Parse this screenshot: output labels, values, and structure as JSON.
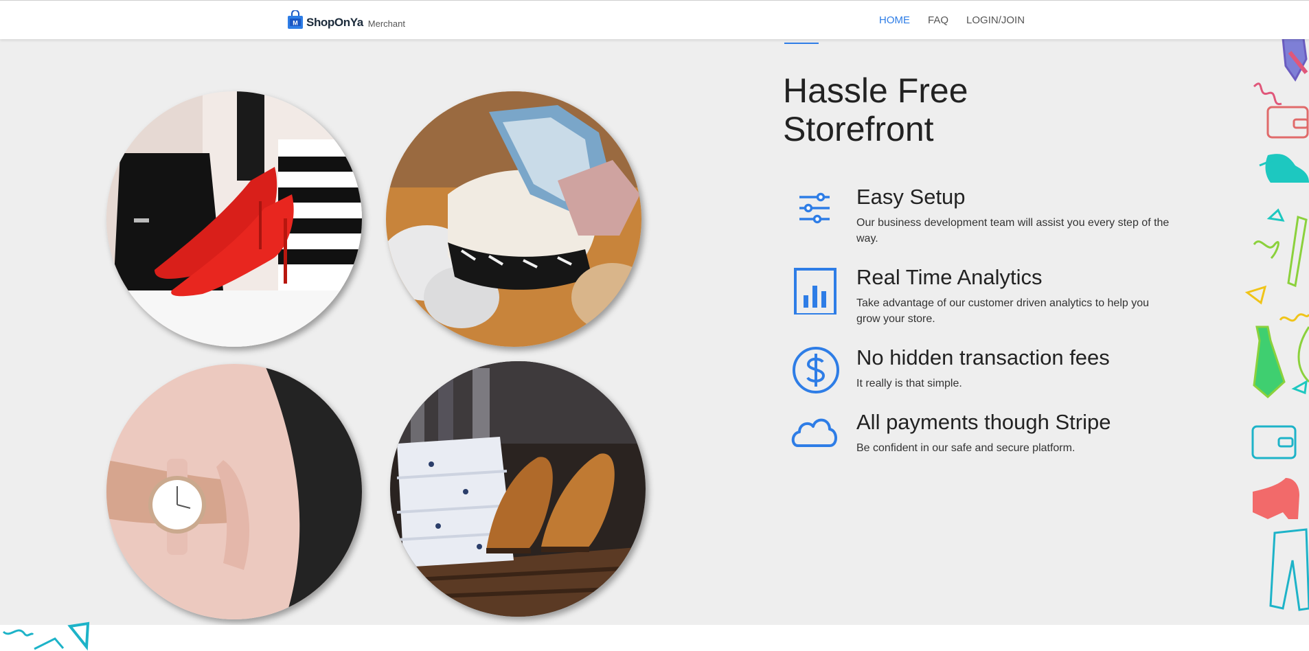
{
  "header": {
    "brand": "ShopOnYa",
    "brand_suffix": "Merchant",
    "nav": [
      {
        "label": "HOME",
        "active": true
      },
      {
        "label": "FAQ",
        "active": false
      },
      {
        "label": "LOGIN/JOIN",
        "active": false
      }
    ]
  },
  "hero": {
    "headline_line1": "Hassle Free",
    "headline_line2": "Storefront",
    "images": [
      {
        "icon": "red-heels-photo"
      },
      {
        "icon": "folded-clothes-photo"
      },
      {
        "icon": "wrist-watch-photo"
      },
      {
        "icon": "shirts-and-shoes-photo"
      }
    ],
    "features": [
      {
        "icon": "sliders-icon",
        "title": "Easy Setup",
        "description": "Our business development team will assist you every step of the way."
      },
      {
        "icon": "bar-chart-icon",
        "title": "Real Time Analytics",
        "description": "Take advantage of our customer driven analytics to help you grow your store."
      },
      {
        "icon": "dollar-icon",
        "title": "No hidden transaction fees",
        "description": "It really is that simple."
      },
      {
        "icon": "cloud-icon",
        "title": "All payments though Stripe",
        "description": "Be confident in our safe and secure platform."
      }
    ]
  },
  "colors": {
    "accent": "#2e7de6",
    "section_bg": "#eeeeee",
    "header_bg": "#ffffff",
    "text": "#222222"
  }
}
